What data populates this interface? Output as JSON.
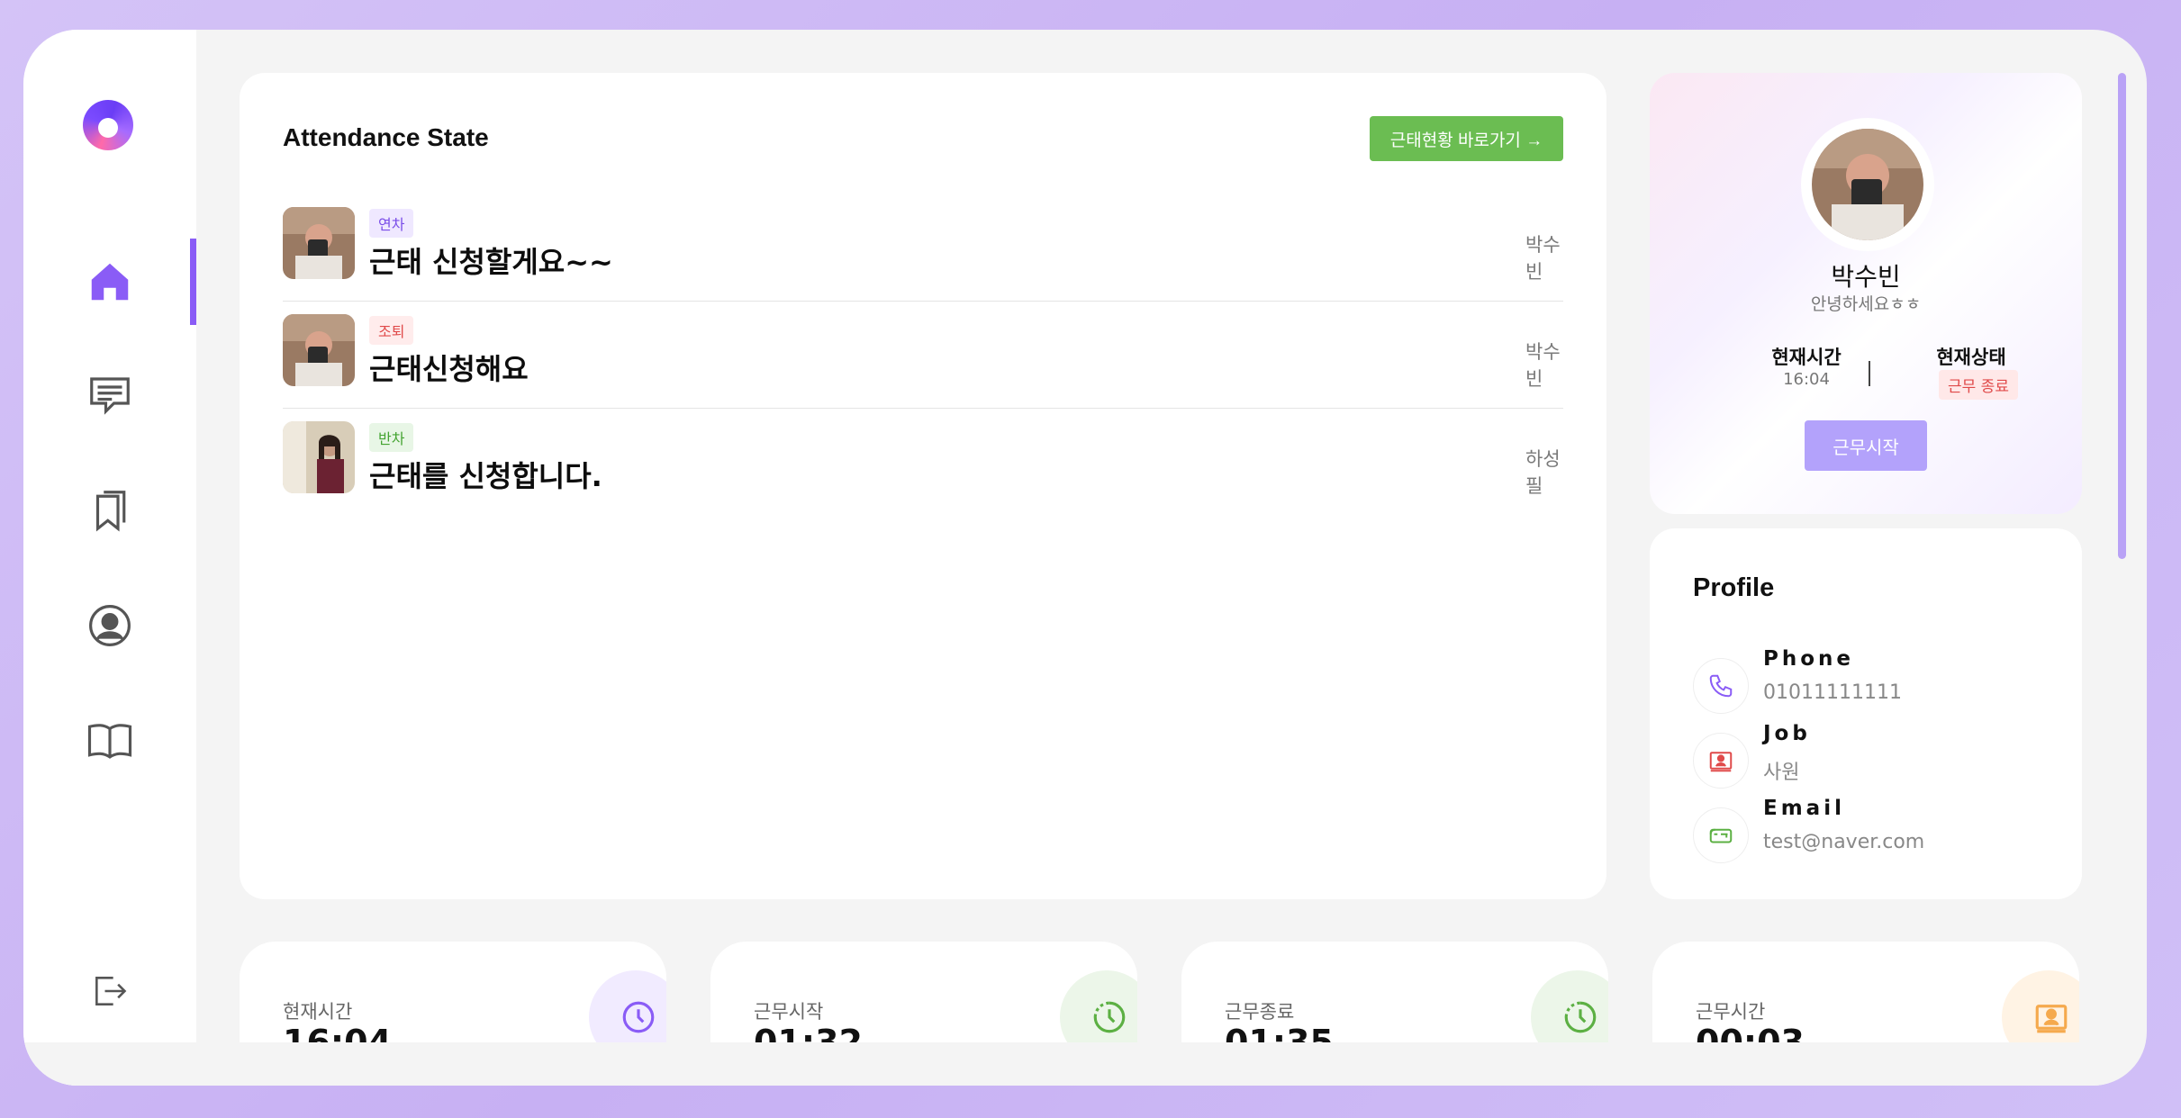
{
  "sidebar": {
    "logo": "app-logo",
    "items": [
      {
        "icon": "home-icon",
        "active": true
      },
      {
        "icon": "chat-icon"
      },
      {
        "icon": "bookmark-icon"
      },
      {
        "icon": "user-icon"
      },
      {
        "icon": "book-icon"
      }
    ],
    "logout_icon": "logout-icon"
  },
  "attendance": {
    "title": "Attendance State",
    "button_label": "근태현황 바로가기 →",
    "rows": [
      {
        "tag": "연차",
        "tag_color": "purple",
        "text": "근태 신청할게요~~",
        "name": "박수빈"
      },
      {
        "tag": "조퇴",
        "tag_color": "red",
        "text": "근태신청해요",
        "name": "박수빈"
      },
      {
        "tag": "반차",
        "tag_color": "green",
        "text": "근태를 신청합니다.",
        "name": "하성필"
      }
    ]
  },
  "profile_card": {
    "name": "박수빈",
    "greeting": "안녕하세요ㅎㅎ",
    "current_time_label": "현재시간",
    "current_time_value": "16:04",
    "status_label": "현재상태",
    "status_value": "근무 종료",
    "start_button": "근무시작"
  },
  "profile_info": {
    "title": "Profile",
    "phone_label": "Phone",
    "phone_value": "01011111111",
    "job_label": "Job",
    "job_value": "사원",
    "email_label": "Email",
    "email_value": "test@naver.com"
  },
  "stats": [
    {
      "label": "현재시간",
      "value": "16:04",
      "color": "#8a5cf6",
      "bg": "#f1ebff"
    },
    {
      "label": "근무시작",
      "value": "01:32",
      "color": "#5cb043",
      "bg": "#ecf6e9"
    },
    {
      "label": "근무종료",
      "value": "01:35",
      "color": "#5cb043",
      "bg": "#ecf6e9"
    },
    {
      "label": "근무시간",
      "value": "00:03",
      "color": "#f5a94d",
      "bg": "#fff3e4"
    }
  ],
  "colors": {
    "accent": "#8a5cf6",
    "green": "#6bbd52",
    "red": "#e04a4a"
  }
}
